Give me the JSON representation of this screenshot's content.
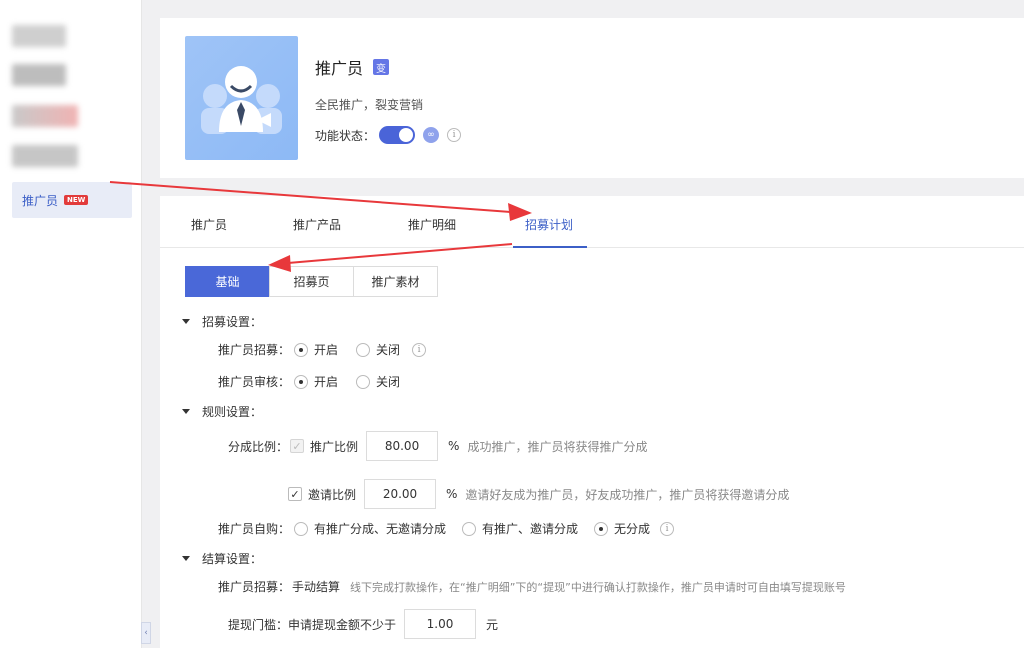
{
  "sidebar": {
    "active_item": {
      "label": "推广员",
      "badge": "NEW"
    },
    "collapse_glyph": "‹"
  },
  "header": {
    "title": "推广员",
    "title_badge": "变",
    "subtitle": "全民推广，裂变营销",
    "status_label": "功能状态：",
    "status_on": true,
    "info_glyph": "i"
  },
  "tabs": [
    "推广员",
    "推广产品",
    "推广明细",
    "招募计划"
  ],
  "segments": [
    "基础",
    "招募页",
    "推广素材"
  ],
  "sections": {
    "recruit": {
      "title": "招募设置：",
      "recruit_label": "推广员招募：",
      "recruit_options": [
        "开启",
        "关闭"
      ],
      "review_label": "推广员审核：",
      "review_options": [
        "开启",
        "关闭"
      ]
    },
    "rules": {
      "title": "规则设置：",
      "split_label": "分成比例：",
      "promote_label": "推广比例",
      "promote_value": "80.00",
      "promote_unit": "%",
      "promote_desc": "成功推广，推广员将获得推广分成",
      "invite_label": "邀请比例",
      "invite_value": "20.00",
      "invite_unit": "%",
      "invite_desc": "邀请好友成为推广员，好友成功推广，推广员将获得邀请分成",
      "self_buy_label": "推广员自购：",
      "self_buy_options": [
        "有推广分成、无邀请分成",
        "有推广、邀请分成",
        "无分成"
      ]
    },
    "settle": {
      "title": "结算设置：",
      "settle_label": "推广员招募：",
      "settle_mode": "手动结算",
      "settle_desc": "线下完成打款操作，在“推广明细”下的“提现”中进行确认打款操作，推广员申请时可自由填写提现账号",
      "threshold_label": "提现门槛：",
      "threshold_text": "申请提现金额不少于",
      "threshold_value": "1.00",
      "threshold_unit": "元"
    }
  },
  "colors": {
    "accent": "#3c5fc7",
    "annotation": "#e8383b"
  }
}
